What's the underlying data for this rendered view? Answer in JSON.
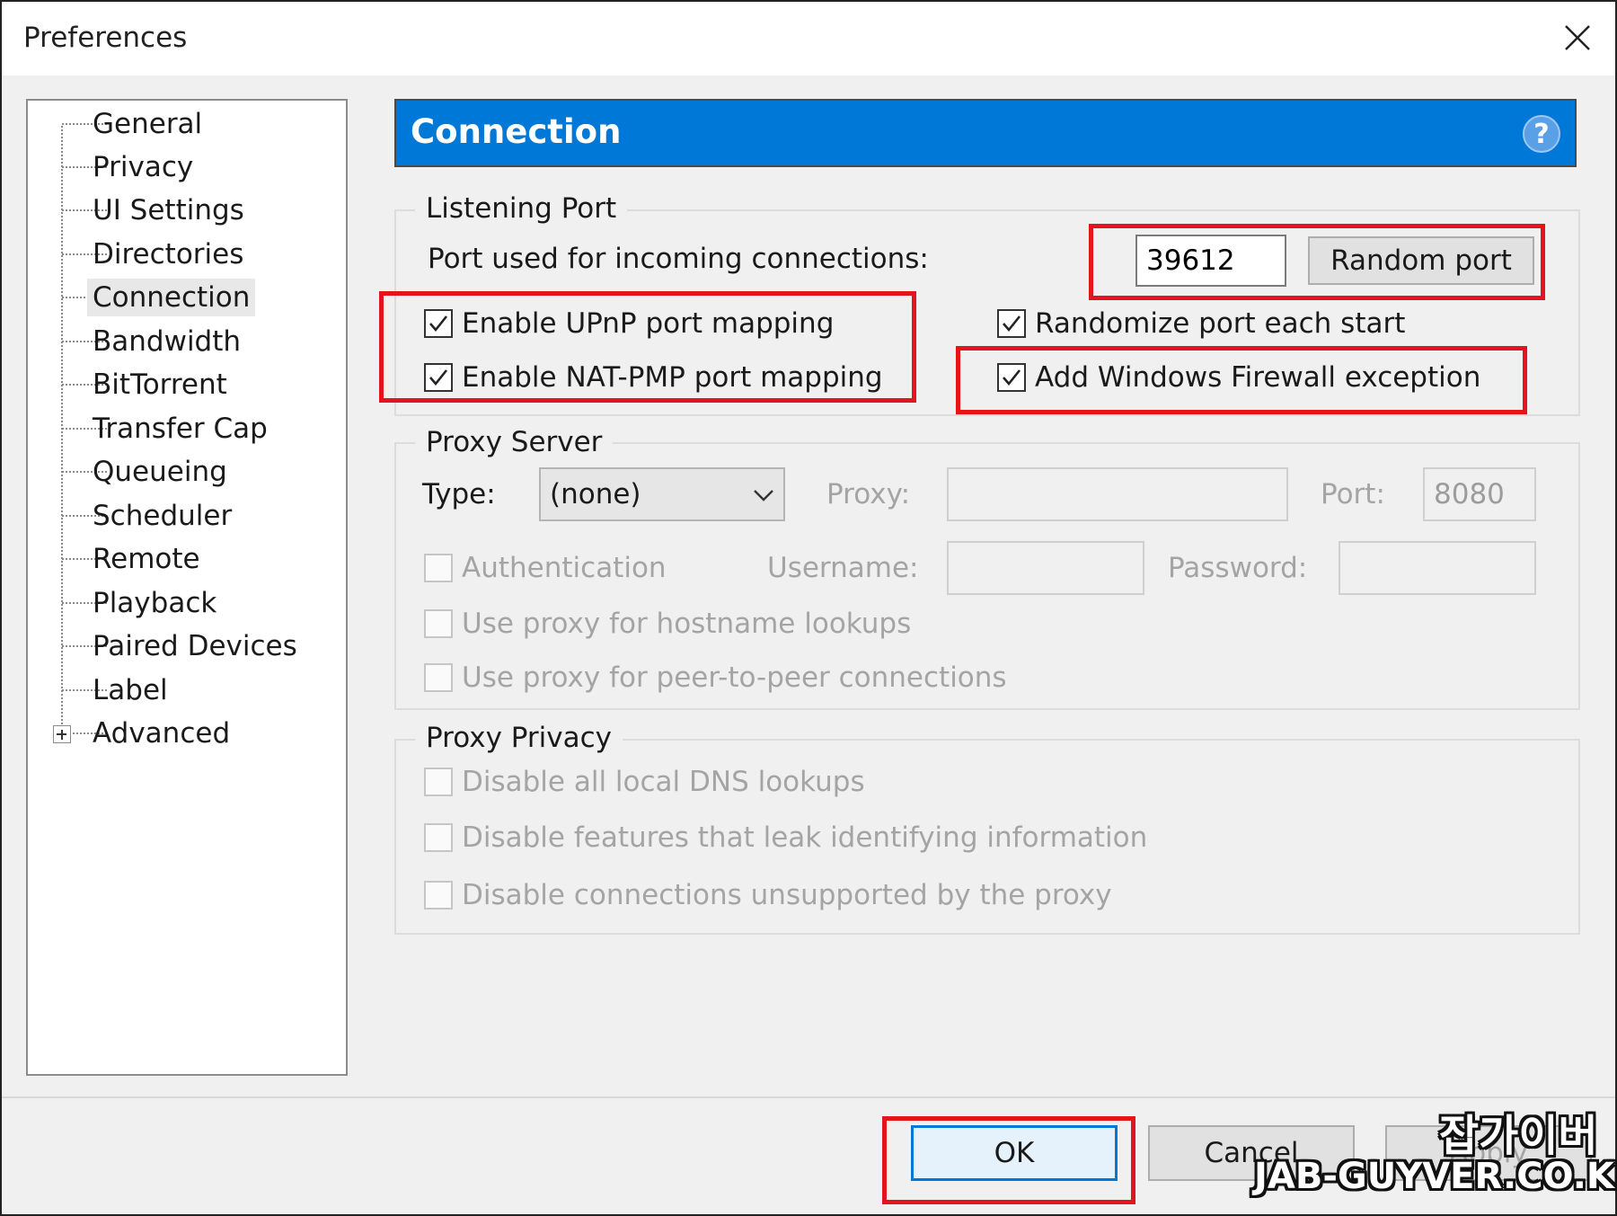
{
  "window": {
    "title": "Preferences"
  },
  "tree": {
    "items": [
      {
        "label": "General"
      },
      {
        "label": "Privacy"
      },
      {
        "label": "UI Settings"
      },
      {
        "label": "Directories"
      },
      {
        "label": "Connection",
        "selected": true
      },
      {
        "label": "Bandwidth"
      },
      {
        "label": "BitTorrent"
      },
      {
        "label": "Transfer Cap"
      },
      {
        "label": "Queueing"
      },
      {
        "label": "Scheduler"
      },
      {
        "label": "Remote"
      },
      {
        "label": "Playback"
      },
      {
        "label": "Paired Devices"
      },
      {
        "label": "Label"
      },
      {
        "label": "Advanced",
        "expandable": true
      }
    ]
  },
  "header": {
    "title": "Connection",
    "help_glyph": "?"
  },
  "listening_port": {
    "legend": "Listening Port",
    "port_label": "Port used for incoming connections:",
    "port_value": "39612",
    "random_port_label": "Random port",
    "upnp_label": "Enable UPnP port mapping",
    "upnp_checked": true,
    "natpmp_label": "Enable NAT-PMP port mapping",
    "natpmp_checked": true,
    "randomize_label": "Randomize port each start",
    "randomize_checked": true,
    "firewall_label": "Add Windows Firewall exception",
    "firewall_checked": true
  },
  "proxy_server": {
    "legend": "Proxy Server",
    "type_label": "Type:",
    "type_value": "(none)",
    "proxy_label": "Proxy:",
    "proxy_value": "",
    "port_label": "Port:",
    "port_value": "8080",
    "auth_label": "Authentication",
    "username_label": "Username:",
    "password_label": "Password:",
    "hostname_label": "Use proxy for hostname lookups",
    "p2p_label": "Use proxy for peer-to-peer connections"
  },
  "proxy_privacy": {
    "legend": "Proxy Privacy",
    "dns_label": "Disable all local DNS lookups",
    "leak_label": "Disable features that leak identifying information",
    "unsupported_label": "Disable connections unsupported by the proxy"
  },
  "footer": {
    "ok_label": "OK",
    "cancel_label": "Cancel",
    "apply_label": "Apply"
  },
  "watermark": {
    "korean": "잡가이버",
    "site": "JAB-GUYVER.CO.KR"
  },
  "colors": {
    "header_bg": "#0078d7",
    "highlight_red": "#e3141b"
  }
}
